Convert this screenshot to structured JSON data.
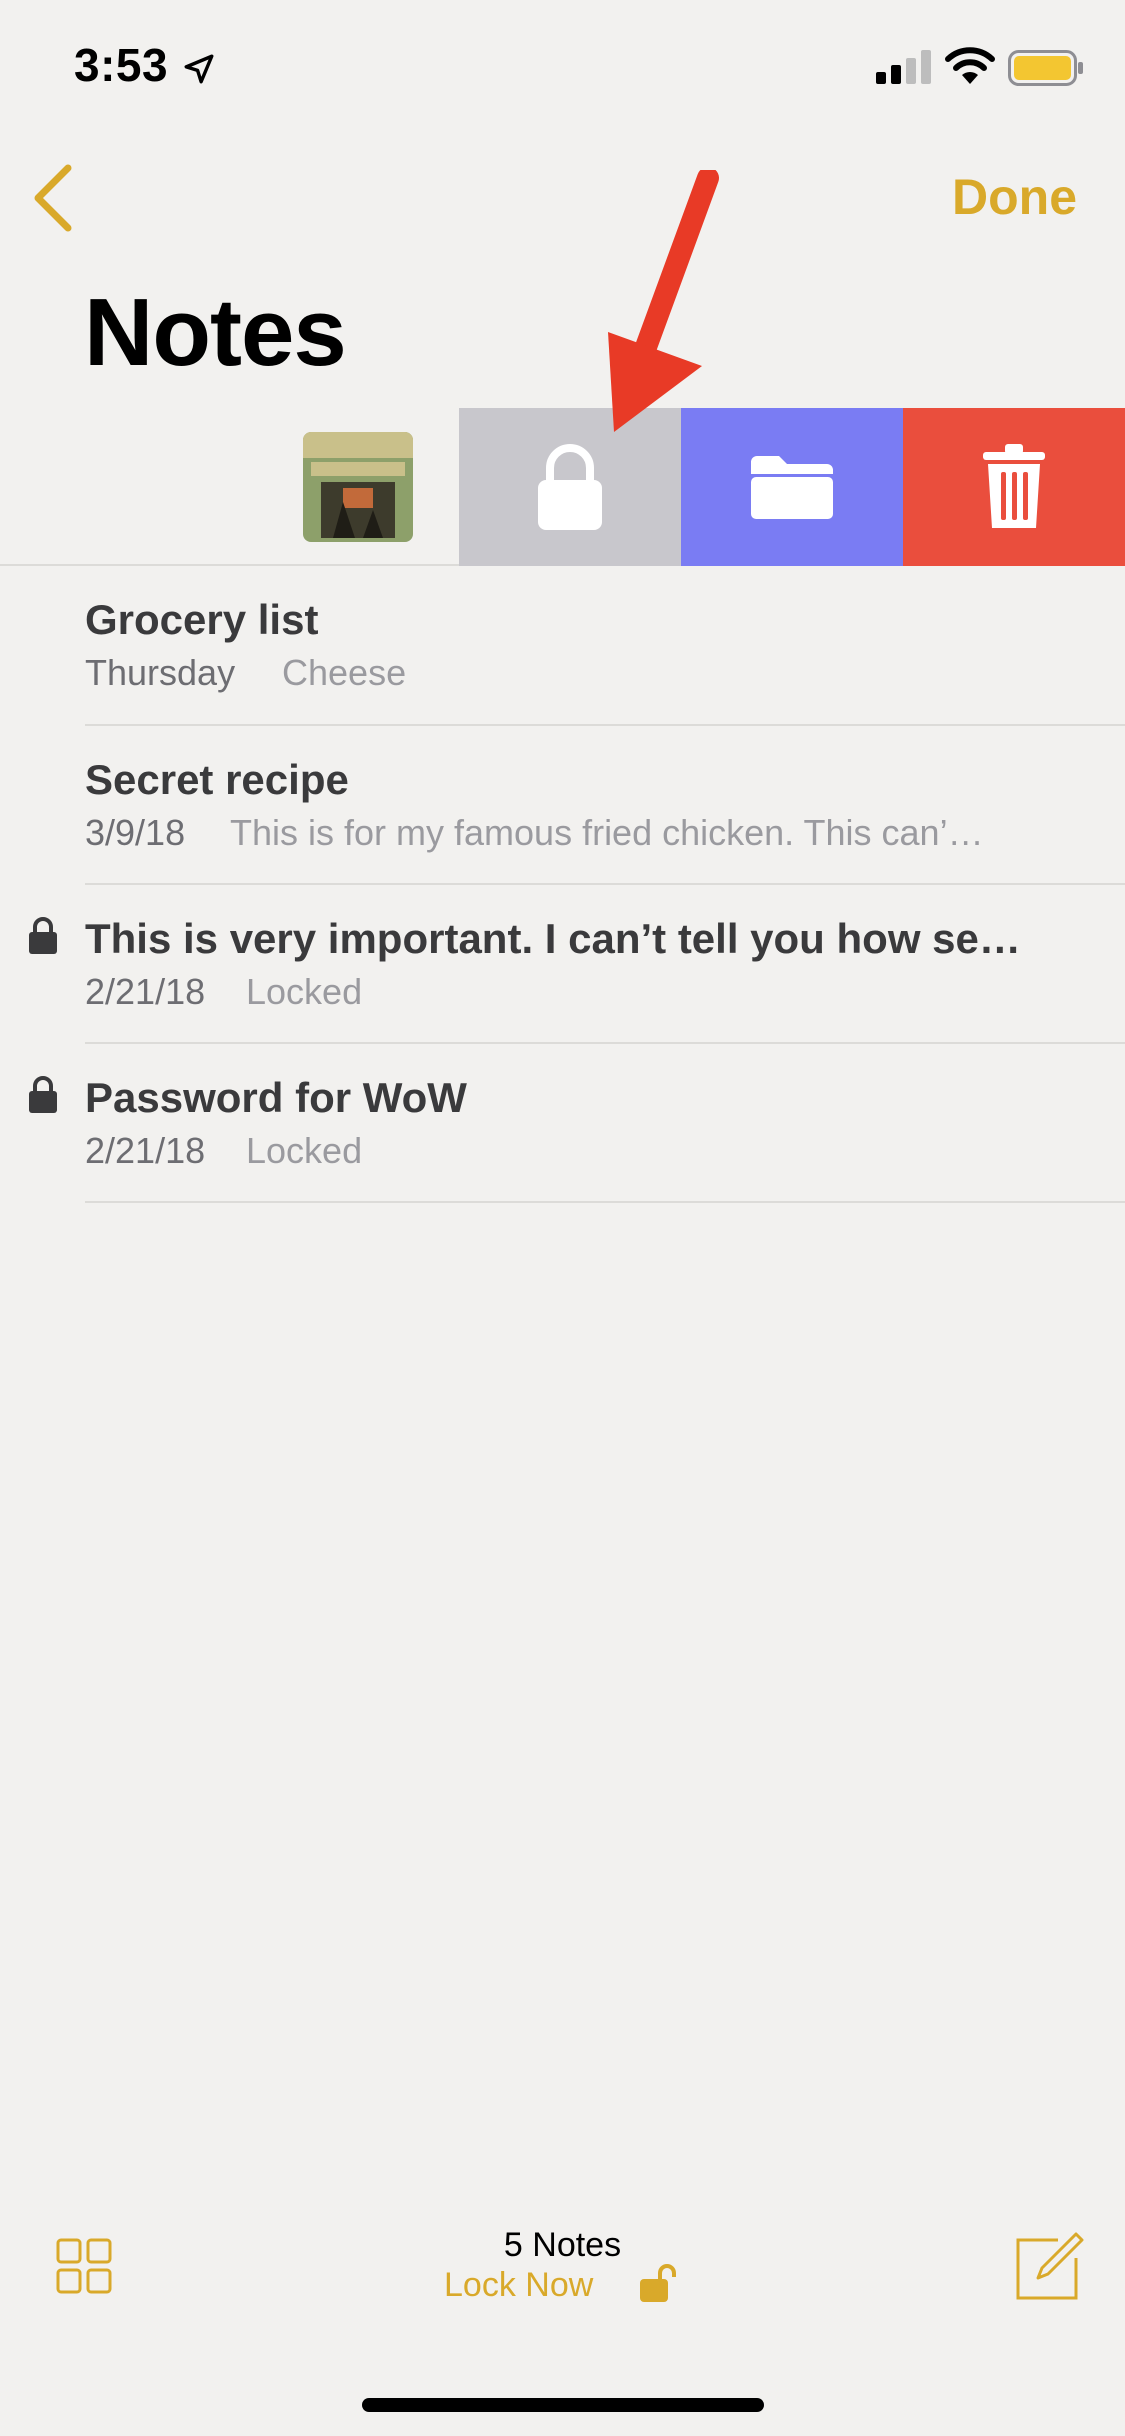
{
  "status_bar": {
    "time": "3:53",
    "icons": [
      "location-arrow-icon",
      "cellular-signal-icon",
      "wifi-icon",
      "battery-icon"
    ]
  },
  "nav": {
    "back_icon": "chevron-left-icon",
    "done_label": "Done",
    "title": "Notes"
  },
  "swipe_actions": {
    "lock_icon": "lock-icon",
    "move_icon": "folder-icon",
    "delete_icon": "trash-icon",
    "colors": {
      "lock": "#c8c7cc",
      "move": "#7a7cf3",
      "delete": "#ea4e3d"
    }
  },
  "notes": [
    {
      "title": "Grocery list",
      "date": "Thursday",
      "preview": "Cheese",
      "locked": false
    },
    {
      "title": "Secret recipe",
      "date": "3/9/18",
      "preview": "This is for my famous fried chicken. This can’…",
      "locked": false
    },
    {
      "title": "This is very important. I can’t tell you how se…",
      "date": "2/21/18",
      "preview": "Locked",
      "locked": true
    },
    {
      "title": "Password for WoW",
      "date": "2/21/18",
      "preview": "Locked",
      "locked": true
    }
  ],
  "toolbar": {
    "gallery_icon": "grid-view-icon",
    "count_label": "5 Notes",
    "lock_now_label": "Lock Now",
    "lock_icon": "unlocked-padlock-icon",
    "compose_icon": "compose-icon"
  },
  "colors": {
    "accent": "#d9a92a",
    "background": "#f2f1ef",
    "annotation_arrow": "#e83a26"
  }
}
